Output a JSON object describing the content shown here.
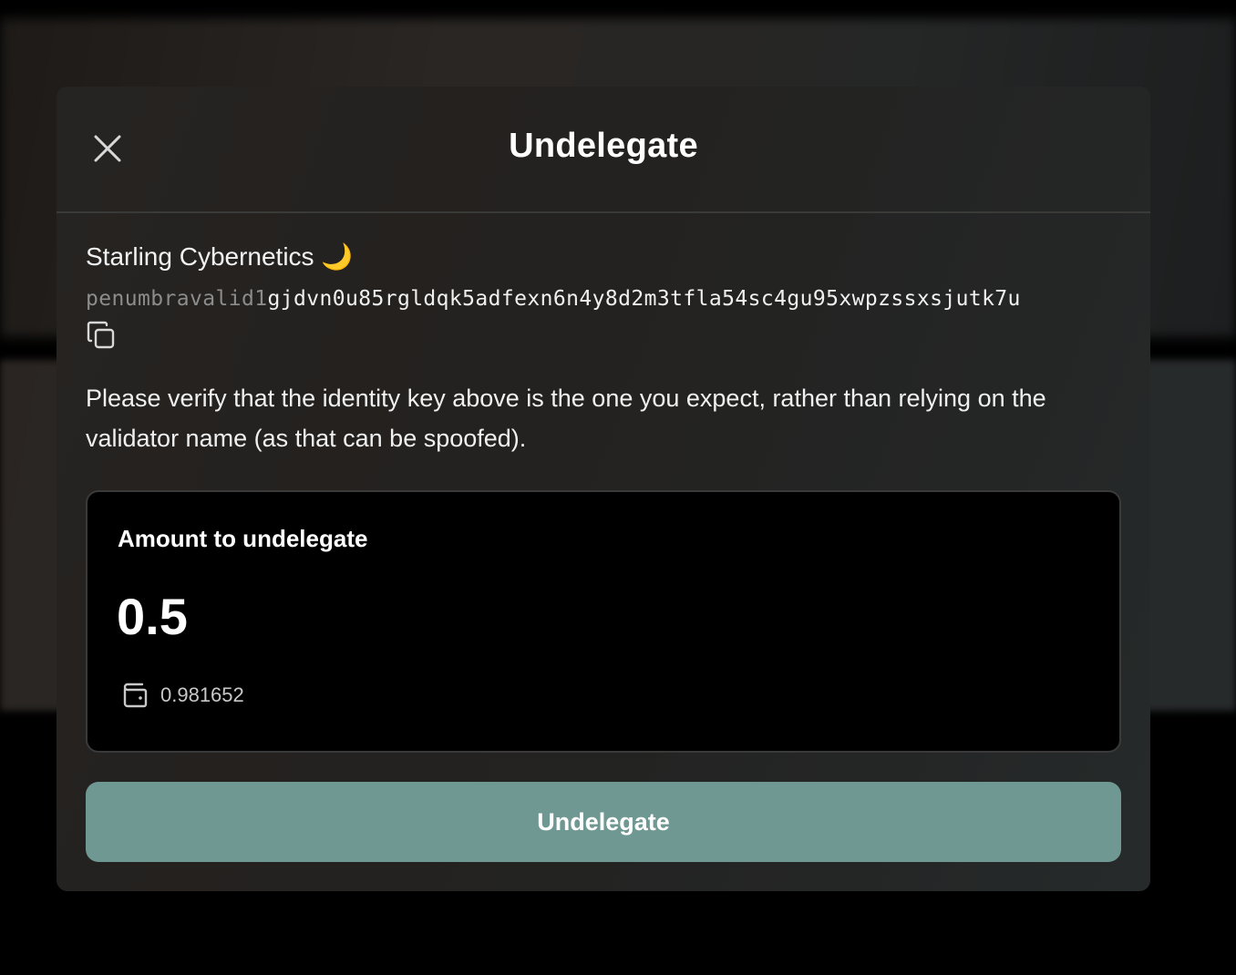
{
  "background": {
    "left_text": "...",
    "right_text": "..."
  },
  "dialog": {
    "title": "Undelegate",
    "close_icon": "close-icon",
    "validator": {
      "name": "Starling Cybernetics 🌙",
      "identity_key_prefix": "penumbravalid1",
      "identity_key_body": "gjdvn0u85rgldqk5adfexn6n4y8d2m3tfla54sc4gu95xwpzssxsjutk7u",
      "copy_icon": "copy-icon"
    },
    "warning": "Please verify that the identity key above is the one you expect, rather than relying on the validator name (as that can be spoofed).",
    "amount": {
      "label": "Amount to undelegate",
      "value": "0.5",
      "balance_icon": "wallet-icon",
      "balance": "0.981652"
    },
    "submit_label": "Undelegate",
    "colors": {
      "submit_button": "#6f9893",
      "card_background": "#000000",
      "text": "#ffffff"
    }
  }
}
